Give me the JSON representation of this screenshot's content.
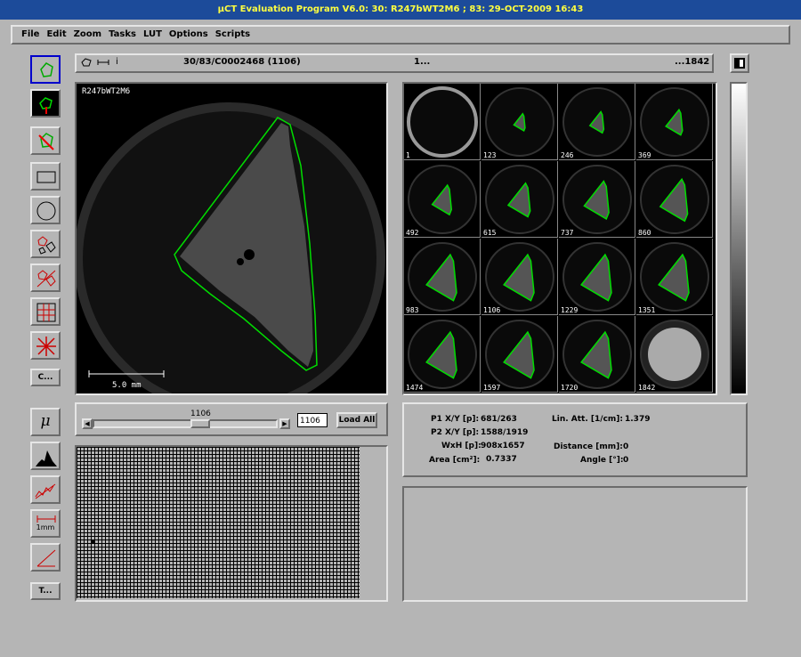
{
  "window": {
    "title": "µCT Evaluation Program V6.0: 30: R247bWT2M6 ; 83: 29-OCT-2009 16:43"
  },
  "menu": [
    "File",
    "Edit",
    "Zoom",
    "Tasks",
    "LUT",
    "Options",
    "Scripts"
  ],
  "info": {
    "sample_id": "30/83/C0002468 (1106)",
    "range_start": "1...",
    "range_end": "...1842",
    "info_icon": "i"
  },
  "image": {
    "label": "R247bWT2M6",
    "scale_label": "5.0 mm"
  },
  "thumbnails": [
    "1",
    "123",
    "246",
    "369",
    "492",
    "615",
    "737",
    "860",
    "983",
    "1106",
    "1229",
    "1351",
    "1474",
    "1597",
    "1720",
    "1842"
  ],
  "slider": {
    "current": "1106",
    "input_value": "1106",
    "load_all": "Load All"
  },
  "tools": {
    "custom_button": "C...",
    "text_button": "T...",
    "mu_symbol": "μ",
    "mm_label": "1mm"
  },
  "measurements": {
    "p1_label": "P1 X/Y [p]:",
    "p1_value": "681/263",
    "p2_label": "P2 X/Y [p]:",
    "p2_value": "1588/1919",
    "wxh_label": "WxH [p]:",
    "wxh_value": "908x1657",
    "area_label": "Area [cm²]:",
    "area_value": "0.7337",
    "lin_att_label": "Lin. Att. [1/cm]:",
    "lin_att_value": "1.379",
    "distance_label": "Distance [mm]:",
    "distance_value": "0",
    "angle_label": "Angle [°]:",
    "angle_value": "0"
  },
  "colors": {
    "title_bg": "#1c4b9a",
    "title_fg": "#ffff40",
    "contour": "#00dd00",
    "panel": "#b5b5b5"
  }
}
